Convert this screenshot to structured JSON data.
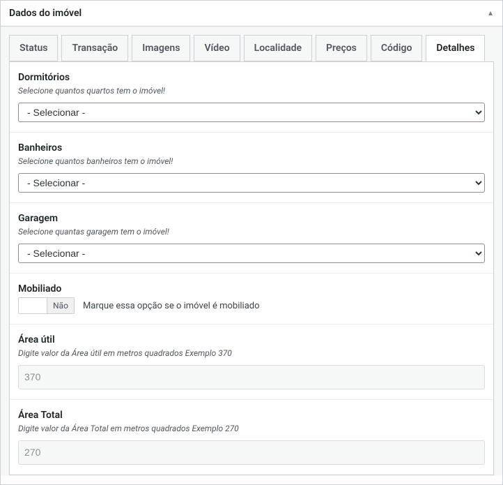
{
  "header": {
    "title": "Dados do imóvel"
  },
  "tabs": [
    {
      "label": "Status"
    },
    {
      "label": "Transação"
    },
    {
      "label": "Imagens"
    },
    {
      "label": "Vídeo"
    },
    {
      "label": "Localidade"
    },
    {
      "label": "Preços"
    },
    {
      "label": "Código"
    },
    {
      "label": "Detalhes"
    }
  ],
  "fields": {
    "dormitorios": {
      "label": "Dormitórios",
      "desc": "Selecione quantos quartos tem o imóvel!",
      "placeholder": "- Selecionar -"
    },
    "banheiros": {
      "label": "Banheiros",
      "desc": "Selecione quantos banheiros tem o imóvel!",
      "placeholder": "- Selecionar -"
    },
    "garagem": {
      "label": "Garagem",
      "desc": "Selecione quantas garagem tem o imóvel!",
      "placeholder": "- Selecionar -"
    },
    "mobiliado": {
      "label": "Mobiliado",
      "switch_state": "Não",
      "hint": "Marque essa opção se o imóvel é mobiliado"
    },
    "area_util": {
      "label": "Área útil",
      "desc": "Digite valor da Área útil em metros quadrados Exemplo 370",
      "placeholder": "370"
    },
    "area_total": {
      "label": "Área Total",
      "desc": "Digite valor da Área Total em metros quadrados Exemplo 270",
      "placeholder": "270"
    }
  }
}
